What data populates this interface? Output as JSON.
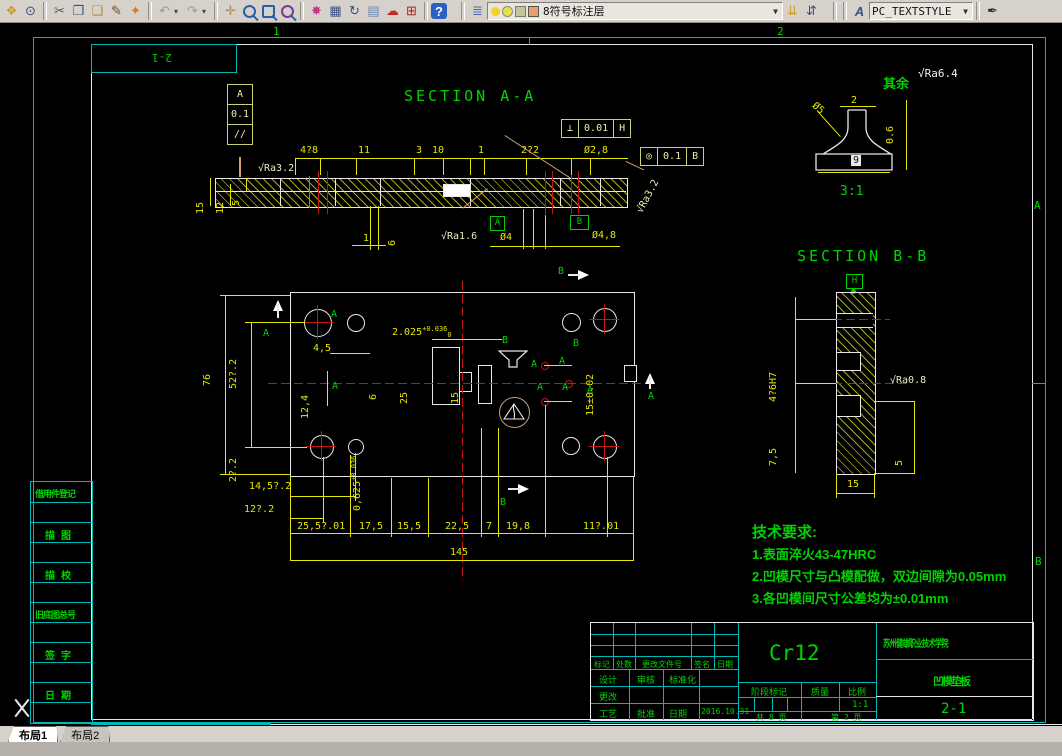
{
  "toolbar": {
    "layer_combo": "8符号标注层",
    "textstyle_combo": "PC_TEXTSTYLE"
  },
  "tabs": {
    "layout1": "布局1",
    "layout2": "布局2"
  },
  "zones": {
    "top1": "1",
    "top2": "2",
    "right_a": "A",
    "right_b": "B",
    "corner_no": "2-1"
  },
  "section_aa": {
    "title": "SECTION A-A",
    "dims_top": [
      "4?8",
      "11",
      "3",
      "10",
      "1",
      "2?2"
    ],
    "dia_28": "Ø2,8",
    "fcf_perp": {
      "sym": "⊥",
      "val": "0.01",
      "datum": "H"
    },
    "fcf_conc": {
      "sym": "◎",
      "val": "0.1",
      "datum": "B"
    },
    "fcf_para": {
      "datum": "A",
      "val": "0.1",
      "sym": "//"
    },
    "ra_left": "√Ra3.2",
    "ra_mid": "√Ra1.6",
    "ra_right": "√Ra3.2",
    "dim_15": "15",
    "dim_12": "12",
    "dim_5": "5",
    "dim_1": "1",
    "dim_6": "6",
    "dia_4": "Ø4",
    "dia_48": "Ø4,8",
    "datum_a": "A",
    "datum_b": "B"
  },
  "detail": {
    "qiyu": "其余",
    "ra": "√Ra6.4",
    "dim_2": "2",
    "dia_5": "Ø5",
    "dim_06": "0.6",
    "dim_9": "9",
    "scale": "3:1"
  },
  "section_bb": {
    "title": "SECTION B-B",
    "datum_h": "H",
    "dim_46h7": "4?6H7",
    "dim_75": "7,5",
    "dim_5": "5",
    "dim_15": "15",
    "ra": "√Ra0.8"
  },
  "plan": {
    "dim_76": "76",
    "dim_52": "52?.2",
    "dim_27": "2?.2",
    "dim_145": "145",
    "dims_bottom": [
      "25,5?.01",
      "17,5",
      "15,5",
      "22,5",
      "7",
      "19,8",
      "11?.01"
    ],
    "dim_1452": "14,5?.2",
    "dim_122": "12?.2",
    "dim_2025": "2.025",
    "tol_hi": "+0.036",
    "tol_lo": "0",
    "dim_45": "4,5",
    "dim_124": "12,4",
    "dim_0625": "0,625",
    "dim_25": "25",
    "dim_6": "6",
    "dim_15": "15",
    "dim_15t": "15±0.02",
    "label_a": "A",
    "label_b": "B"
  },
  "tech_req": {
    "title": "技术要求:",
    "lines": [
      "1.表面淬火43-47HRC",
      "2.凹模尺寸与凸模配做，双边间隙为0.05mm",
      "3.各凹模间尺寸公差均为±0.01mm"
    ]
  },
  "title_block": {
    "material": "Cr12",
    "school": "苏州健雄职业技术学院",
    "part_name": "凹模垫板",
    "drawing_no": "2-1",
    "row_labels": [
      "标记",
      "处数",
      "更改文件号",
      "签名",
      "日期"
    ],
    "design": "设计",
    "check": "审核",
    "standard": "标准化",
    "change": "更改",
    "process": "工艺",
    "approve": "批准",
    "date_label": "日期",
    "date": "2016.10.31",
    "stage": "阶段标记",
    "quality": "质量",
    "scale_label": "比例",
    "scale": "1:1",
    "sheets": "共 8 页",
    "sheet_no": "第 2 页"
  },
  "left_strip": {
    "items": [
      "借用件登记",
      "描图",
      "描校",
      "旧底图总号",
      "签字",
      "日期"
    ]
  }
}
